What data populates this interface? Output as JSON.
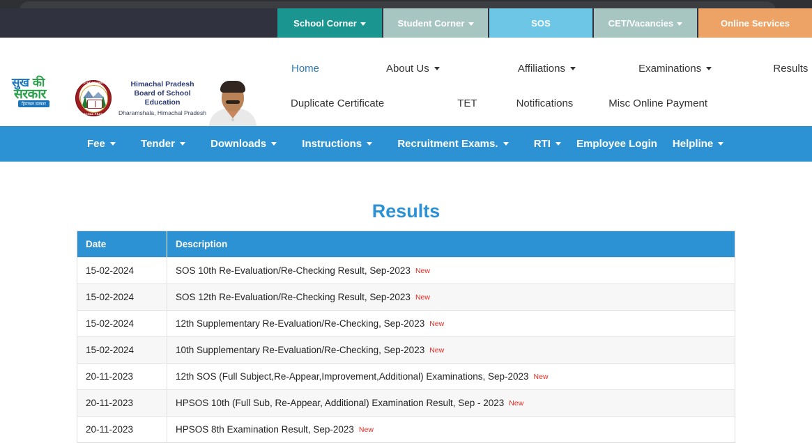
{
  "browser": {
    "urlbar_placeholder": ""
  },
  "topbar": {
    "tabs": [
      {
        "label": "School Corner",
        "has_caret": true,
        "color": "#1a958f"
      },
      {
        "label": "Student Corner",
        "has_caret": true,
        "color": "#a7c6c2"
      },
      {
        "label": "SOS",
        "has_caret": false,
        "color": "#6dc6e5"
      },
      {
        "label": "CET/Vacancies",
        "has_caret": true,
        "color": "#a7c6c2"
      },
      {
        "label": "Online Services",
        "has_caret": false,
        "color": "#eda366"
      }
    ]
  },
  "brand": {
    "sukh_line1_a": "सुख",
    "sukh_line1_b": "की",
    "sukh_line2": "सरकार",
    "sukh_line3": "हिमाचल सरकार",
    "emblem_top_text": "BOARD OF SCHOOL EDUCATION",
    "emblem_bottom_text": "HIMACHAL PRADESH",
    "title_line1": "Himachal Pradesh",
    "title_line2": "Board of School Education",
    "title_line3": "Dharamshala, Himachal Pradesh"
  },
  "menu": {
    "row1": [
      {
        "label": "Home",
        "active": true,
        "has_caret": false
      },
      {
        "label": "About Us",
        "active": false,
        "has_caret": true
      },
      {
        "label": "Affiliations",
        "active": false,
        "has_caret": true
      },
      {
        "label": "Examinations",
        "active": false,
        "has_caret": true
      },
      {
        "label": "Results",
        "active": false,
        "has_caret": false
      }
    ],
    "row2": [
      {
        "label": "Duplicate Certificate",
        "active": false,
        "has_caret": false
      },
      {
        "label": "TET",
        "active": false,
        "has_caret": false
      },
      {
        "label": "Notifications",
        "active": false,
        "has_caret": false
      },
      {
        "label": "Misc Online Payment",
        "active": false,
        "has_caret": false
      }
    ]
  },
  "bluebar": {
    "items": [
      {
        "label": "Fee",
        "has_caret": true
      },
      {
        "label": "Tender",
        "has_caret": true
      },
      {
        "label": "Downloads",
        "has_caret": true
      },
      {
        "label": "Instructions",
        "has_caret": true
      },
      {
        "label": "Recruitment Exams.",
        "has_caret": true
      },
      {
        "label": "RTI",
        "has_caret": true
      },
      {
        "label": "Employee Login",
        "has_caret": false
      },
      {
        "label": "Helpline",
        "has_caret": true
      }
    ]
  },
  "main": {
    "page_title": "Results",
    "table": {
      "columns": [
        "Date",
        "Description"
      ],
      "rows": [
        {
          "date": "15-02-2024",
          "description": "SOS 10th Re-Evaluation/Re-Checking Result, Sep-2023",
          "badge": "New"
        },
        {
          "date": "15-02-2024",
          "description": "SOS 12th Re-Evaluation/Re-Checking Result, Sep-2023",
          "badge": "New"
        },
        {
          "date": "15-02-2024",
          "description": "12th Supplementary Re-Evaluation/Re-Checking, Sep-2023",
          "badge": "New"
        },
        {
          "date": "15-02-2024",
          "description": "10th Supplementary Re-Evaluation/Re-Checking, Sep-2023",
          "badge": "New"
        },
        {
          "date": "20-11-2023",
          "description": "12th SOS (Full Subject,Re-Appear,Improvement,Additional) Examinations, Sep-2023",
          "badge": "New"
        },
        {
          "date": "20-11-2023",
          "description": "HPSOS 10th (Full Sub, Re-Appear, Additional) Examination Result, Sep - 2023",
          "badge": "New"
        },
        {
          "date": "20-11-2023",
          "description": "HPSOS 8th Examination Result, Sep-2023",
          "badge": "New"
        }
      ]
    }
  },
  "colors": {
    "accent_blue": "#2c92d4",
    "topbar_dark": "#313240",
    "new_badge_red": "#e8281f",
    "title_navy": "#2b3a72"
  }
}
